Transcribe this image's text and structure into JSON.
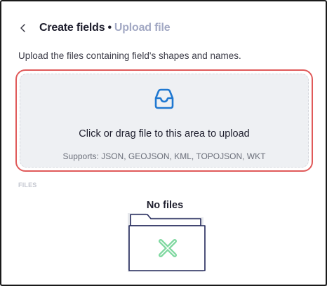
{
  "header": {
    "back_icon": "chevron-left-icon",
    "title": "Create fields",
    "separator": "•",
    "subtitle": "Upload file"
  },
  "description": "Upload the files containing field's shapes and names.",
  "dropzone": {
    "icon": "inbox-icon",
    "text": "Click or drag file to this area to upload",
    "supports": "Supports: JSON, GEOJSON, KML, TOPOJSON, WKT",
    "highlight_color": "#e05a5a",
    "icon_color": "#1f78d1"
  },
  "files": {
    "section_label": "FILES",
    "empty_title": "No files",
    "empty_icon": "empty-folder-x-icon",
    "x_color": "#7fd8a0"
  }
}
